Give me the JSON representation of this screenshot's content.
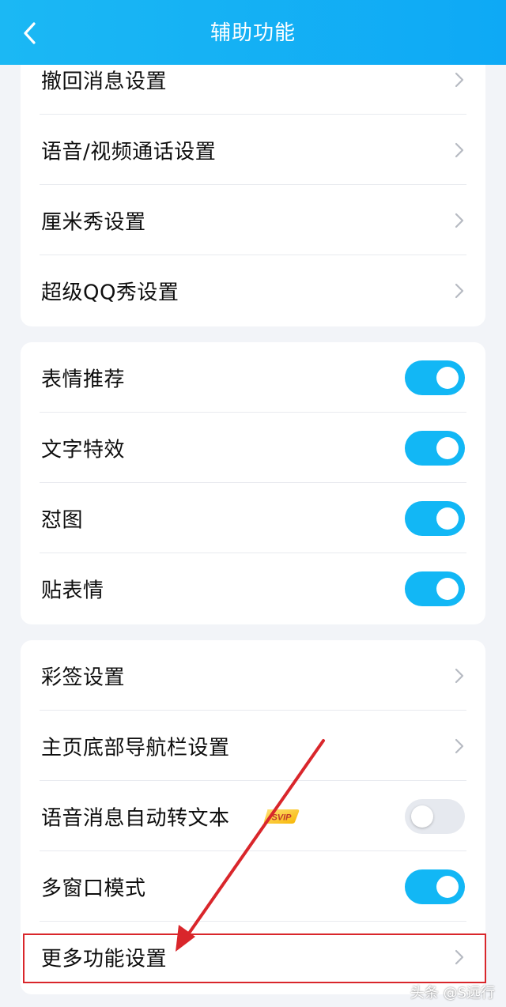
{
  "header": {
    "title": "辅助功能",
    "back_icon": "chevron-left-icon"
  },
  "group1": {
    "items": [
      {
        "label": "撤回消息设置"
      },
      {
        "label": "语音/视频通话设置"
      },
      {
        "label": "厘米秀设置"
      },
      {
        "label": "超级QQ秀设置"
      }
    ]
  },
  "group2": {
    "items": [
      {
        "label": "表情推荐",
        "enabled": true
      },
      {
        "label": "文字特效",
        "enabled": true
      },
      {
        "label": "怼图",
        "enabled": true
      },
      {
        "label": "贴表情",
        "enabled": true
      }
    ]
  },
  "group3": {
    "items": [
      {
        "label": "彩签设置"
      },
      {
        "label": "主页底部导航栏设置"
      },
      {
        "label": "语音消息自动转文本",
        "badge": "SVIP",
        "enabled": false
      },
      {
        "label": "多窗口模式",
        "enabled": true
      },
      {
        "label": "更多功能设置"
      }
    ]
  },
  "watermark": "头条 @S远行",
  "colors": {
    "header_start": "#1bb8f4",
    "header_end": "#0ea9f5",
    "toggle_on": "#12b7f5",
    "toggle_off": "#e6e9ef",
    "annotation_red": "#d9262b"
  }
}
